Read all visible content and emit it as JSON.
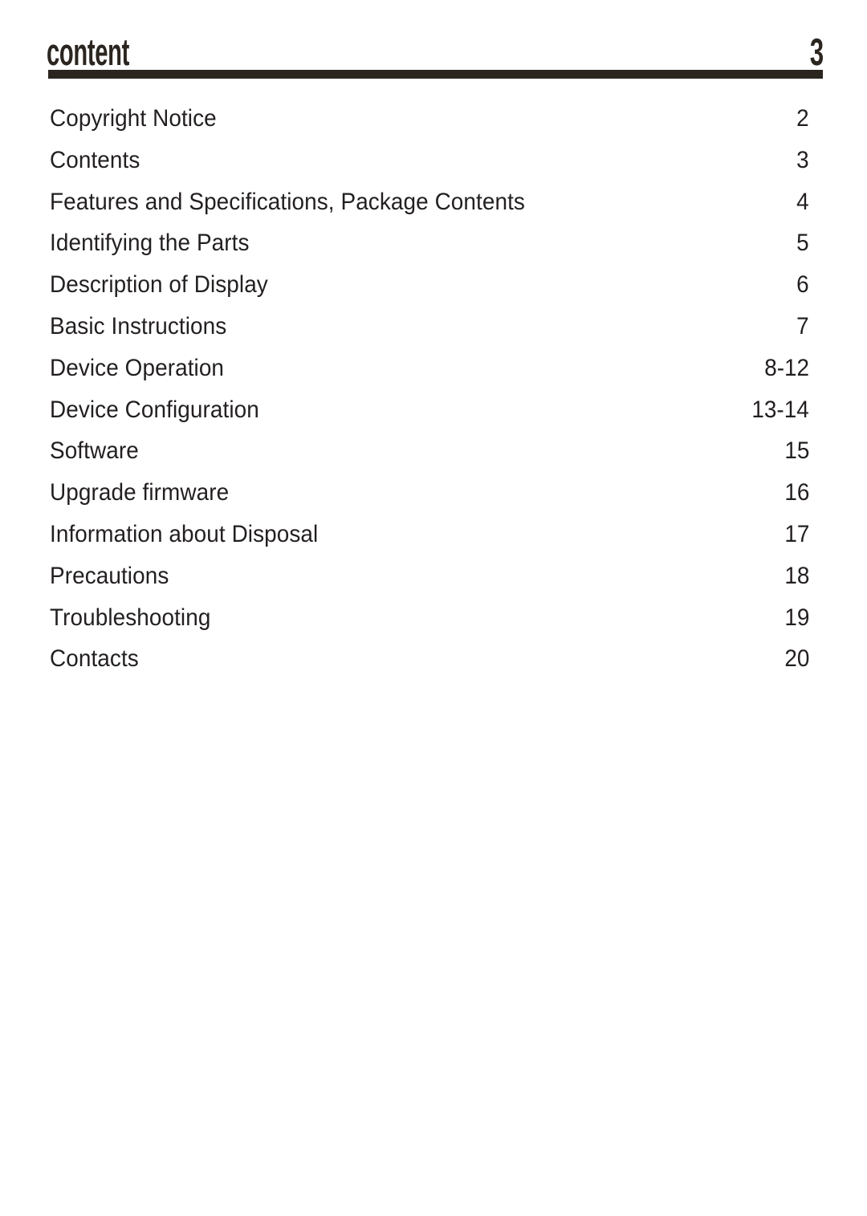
{
  "header": {
    "title": "content",
    "page_number": "3"
  },
  "colors": {
    "rule": "#2b2520",
    "title_text": "#2b2520",
    "body_text": "#231f20",
    "background": "#ffffff"
  },
  "toc": {
    "entries": [
      {
        "title": "Copyright Notice",
        "page": "2"
      },
      {
        "title": "Contents",
        "page": "3"
      },
      {
        "title": "Features and Specifications, Package Contents",
        "page": "4"
      },
      {
        "title": "Identifying the Parts",
        "page": "5"
      },
      {
        "title": "Description of Display",
        "page": "6"
      },
      {
        "title": "Basic Instructions",
        "page": "7"
      },
      {
        "title": "Device Operation",
        "page": "8-12"
      },
      {
        "title": "Device Configuration",
        "page": "13-14"
      },
      {
        "title": "Software",
        "page": "15"
      },
      {
        "title": "Upgrade firmware",
        "page": "16"
      },
      {
        "title": "Information about Disposal",
        "page": "17"
      },
      {
        "title": "Precautions",
        "page": "18"
      },
      {
        "title": "Troubleshooting",
        "page": "19"
      },
      {
        "title": "Contacts",
        "page": "20"
      }
    ]
  }
}
